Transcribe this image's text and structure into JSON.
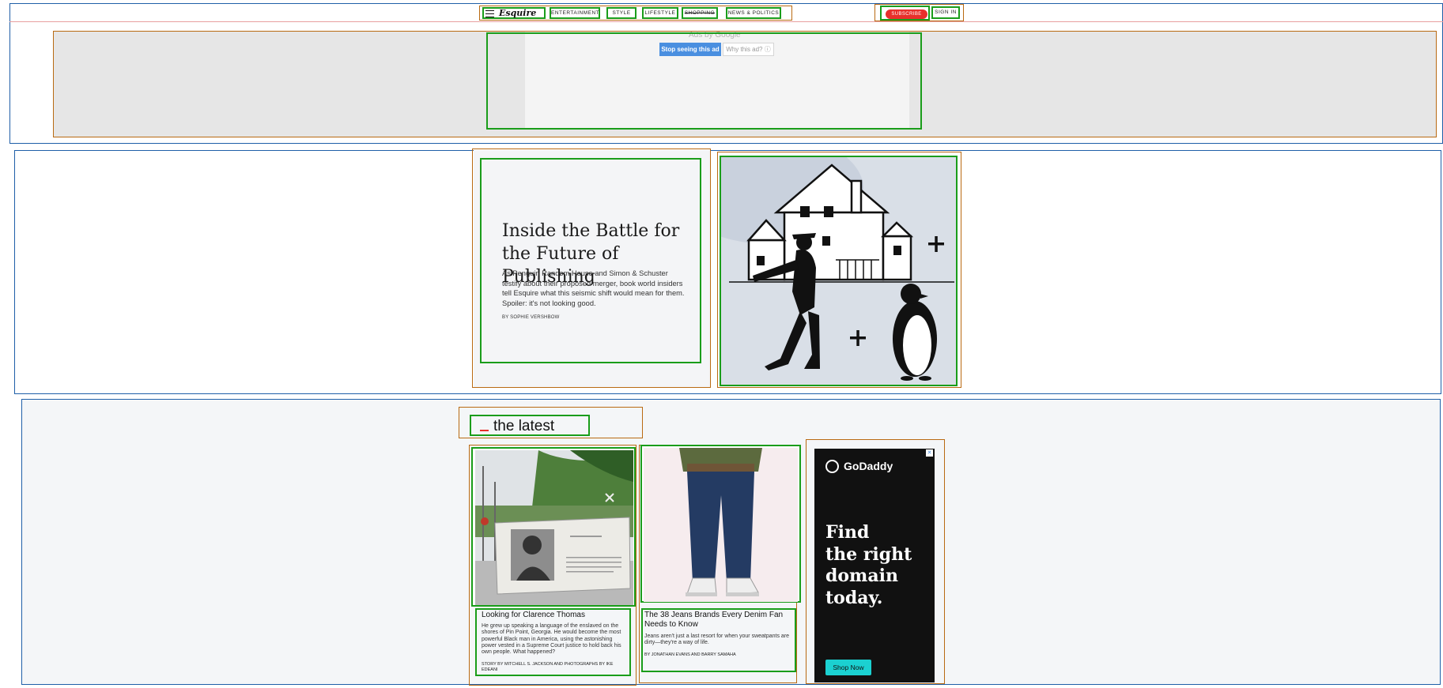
{
  "header": {
    "logo": "Esquire",
    "nav": [
      "ENTERTAINMENT",
      "STYLE",
      "LIFESTYLE",
      "SHOPPING",
      "NEWS & POLITICS"
    ],
    "subscribe": "SUBSCRIBE",
    "sign_in": "SIGN IN"
  },
  "ad": {
    "ads_by": "Ads by Google",
    "stop_label": "Stop seeing this ad",
    "why_label": "Why this ad? ⓘ"
  },
  "feature": {
    "title": "Inside the Battle for the Future of Publishing",
    "dek": "As Penguin Random House and Simon & Schuster testify about their proposed merger, book world insiders tell Esquire what this seismic shift would mean for them. Spoiler: it's not looking good.",
    "byline": "BY SOPHIE VERSHBOW"
  },
  "latest": {
    "heading": "the latest",
    "cards": [
      {
        "title": "Looking for Clarence Thomas",
        "dek": "He grew up speaking a language of the enslaved on the shores of Pin Point, Georgia. He would become the most powerful Black man in America, using the astonishing power vested in a Supreme Court justice to hold back his own people. What happened?",
        "byline": "STORY BY MITCHELL S. JACKSON AND PHOTOGRAPHS BY IKE EDEANI"
      },
      {
        "title": "The 38 Jeans Brands Every Denim Fan Needs to Know",
        "dek": "Jeans aren't just a last resort for when your sweatpants are dirty—they're a way of life.",
        "byline": "BY JONATHAN EVANS AND BARRY SAMAHA"
      }
    ]
  },
  "sidebar_ad": {
    "brand": "GoDaddy",
    "headline_lines": [
      "Find",
      "the right",
      "domain",
      "today."
    ],
    "cta": "Shop Now",
    "close": "✕"
  },
  "colors": {
    "accent_red": "#e8302b",
    "ad_blue": "#4a8fe0",
    "godaddy_teal": "#1bd1d1"
  }
}
